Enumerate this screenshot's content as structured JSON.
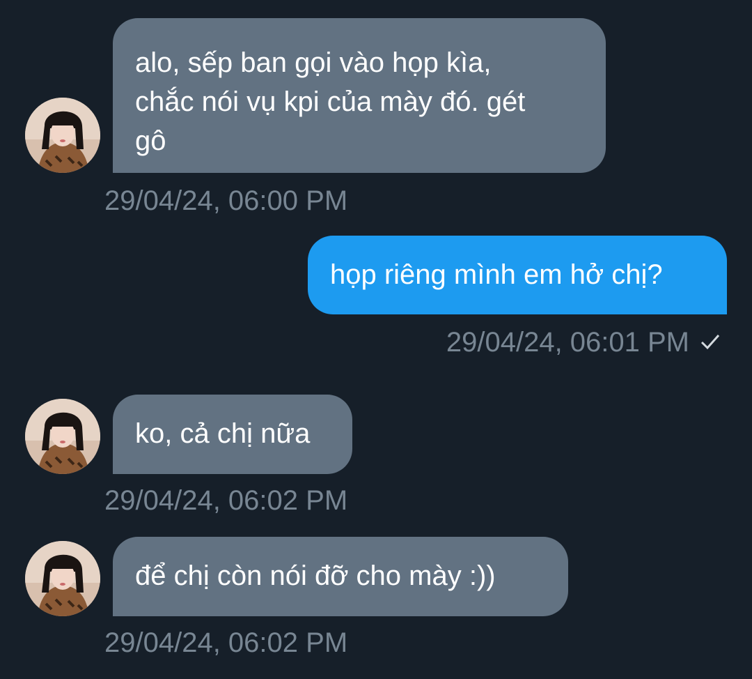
{
  "messages": [
    {
      "direction": "incoming",
      "text": "alo, sếp ban gọi vào họp kìa, chắc nói vụ kpi của mày đó. gét gô",
      "lines": [
        "alo, sếp ban gọi vào họp kìa,",
        "chắc nói vụ kpi của mày đó. gét",
        "gô"
      ],
      "timestamp": "29/04/24, 06:00 PM"
    },
    {
      "direction": "outgoing",
      "text": "họp riêng mình em hở chị?",
      "timestamp": "29/04/24, 06:01 PM",
      "status_icon": "checkmark-icon"
    },
    {
      "direction": "incoming",
      "text": "ko, cả chị nữa",
      "timestamp": "29/04/24, 06:02 PM"
    },
    {
      "direction": "incoming",
      "text": "để chị còn nói đỡ cho mày :))",
      "timestamp": "29/04/24, 06:02 PM"
    }
  ],
  "colors": {
    "background": "#161f29",
    "incoming_bubble": "#627282",
    "outgoing_bubble": "#1d9bf0",
    "timestamp_text": "#788693",
    "message_text": "#ffffff"
  }
}
